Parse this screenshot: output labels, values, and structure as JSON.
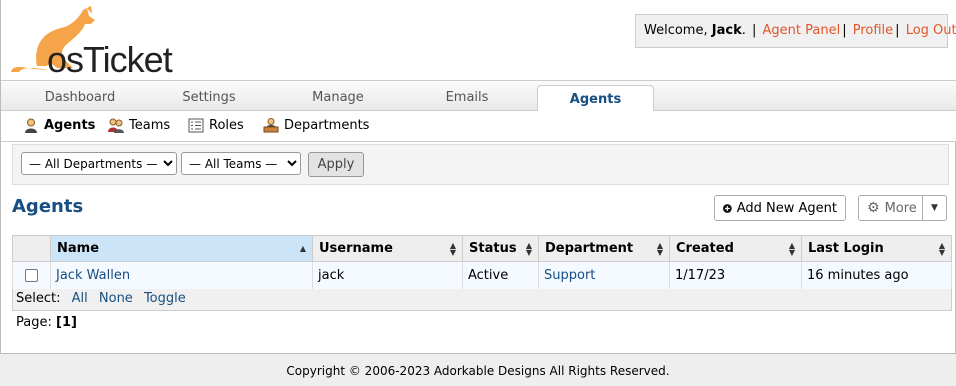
{
  "header": {
    "logo_text": "osTicket",
    "welcome": "Welcome,",
    "username": "Jack",
    "links": {
      "agent_panel": "Agent Panel",
      "profile": "Profile",
      "logout": "Log Out"
    }
  },
  "nav": {
    "tabs": [
      "Dashboard",
      "Settings",
      "Manage",
      "Emails",
      "Agents"
    ],
    "active": "Agents"
  },
  "subnav": {
    "items": [
      "Agents",
      "Teams",
      "Roles",
      "Departments"
    ]
  },
  "filters": {
    "department": "— All Departments —",
    "team": "— All Teams —",
    "apply": "Apply"
  },
  "page": {
    "title": "Agents",
    "add_button": "Add New Agent",
    "more_button": "More"
  },
  "table": {
    "headers": [
      "Name",
      "Username",
      "Status",
      "Department",
      "Created",
      "Last Login"
    ],
    "rows": [
      {
        "name": "Jack Wallen",
        "username": "jack",
        "status": "Active",
        "department": "Support",
        "created": "1/17/23",
        "last_login": "16 minutes ago"
      }
    ]
  },
  "select_bar": {
    "label": "Select:",
    "all": "All",
    "none": "None",
    "toggle": "Toggle"
  },
  "pager": {
    "label": "Page:",
    "current": "[1]"
  },
  "footer": {
    "copyright": "Copyright © 2006-2023 Adorkable Designs All Rights Reserved."
  },
  "colors": {
    "accent": "#184e81",
    "link_orange": "#e0562a",
    "logo_orange": "#f5a44a"
  }
}
